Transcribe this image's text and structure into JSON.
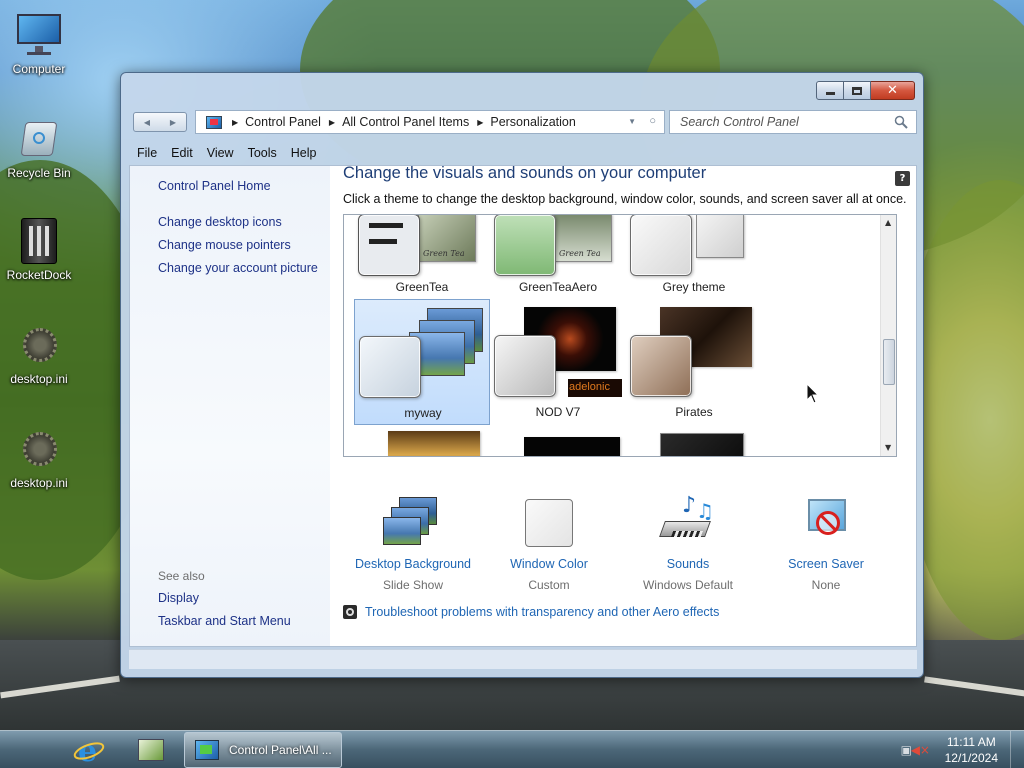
{
  "desktop": {
    "icons": [
      {
        "label": "Computer",
        "icon": "monitor-icon"
      },
      {
        "label": "Recycle Bin",
        "icon": "recycle-bin-icon"
      },
      {
        "label": "RocketDock",
        "icon": "rocketdock-icon"
      },
      {
        "label": "desktop.ini",
        "icon": "settings-file-icon"
      },
      {
        "label": "desktop.ini",
        "icon": "settings-file-icon"
      }
    ]
  },
  "window": {
    "address": {
      "crumbs": [
        "Control Panel",
        "All Control Panel Items",
        "Personalization"
      ]
    },
    "search": {
      "placeholder": "Search Control Panel"
    },
    "menu": [
      "File",
      "Edit",
      "View",
      "Tools",
      "Help"
    ],
    "help_symbol": "?",
    "left_pane": {
      "home": "Control Panel Home",
      "links": [
        "Change desktop icons",
        "Change mouse pointers",
        "Change your account picture"
      ],
      "see_also": "See also",
      "see_also_links": [
        "Display",
        "Taskbar and Start Menu"
      ]
    },
    "heading": "Change the visuals and sounds on your computer",
    "subheading": "Click a theme to change the desktop background, window color, sounds, and screen saver all at once.",
    "themes": [
      {
        "name": "GreenTea",
        "selected": false,
        "thumb_text": "Green Tea"
      },
      {
        "name": "GreenTeaAero",
        "selected": false,
        "thumb_text": "Green Tea"
      },
      {
        "name": "Grey theme",
        "selected": false
      },
      {
        "name": "myway",
        "selected": true
      },
      {
        "name": "NOD V7",
        "selected": false,
        "thumb_text": "adelonic"
      },
      {
        "name": "Pirates",
        "selected": false
      }
    ],
    "settings": [
      {
        "title": "Desktop Background",
        "value": "Slide Show",
        "icon": "desktop-background-icon"
      },
      {
        "title": "Window Color",
        "value": "Custom",
        "icon": "window-color-icon"
      },
      {
        "title": "Sounds",
        "value": "Windows Default",
        "icon": "sounds-icon"
      },
      {
        "title": "Screen Saver",
        "value": "None",
        "icon": "screen-saver-icon"
      }
    ],
    "troubleshoot": "Troubleshoot problems with transparency and other Aero effects"
  },
  "taskbar": {
    "active_window": "Control Panel\\All ...",
    "clock_time": "11:11 AM",
    "clock_date": "12/1/2024"
  },
  "colors": {
    "accent_link": "#1f66b4",
    "nav_link": "#1e3287",
    "heading": "#1e3e76",
    "selection": "#c1dcfc"
  }
}
